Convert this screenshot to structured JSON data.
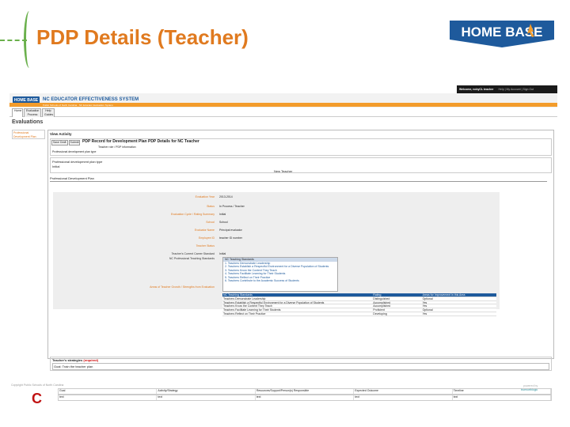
{
  "slide": {
    "title": "PDP Details (Teacher)",
    "logo_text": "HOME BASE"
  },
  "app": {
    "topbar": {
      "welcome": "Welcome, ncbyCL teacher",
      "links": "Help | My Account | Sign Out"
    },
    "logo_text": "HOME BASE",
    "system_name": "NC EDUCATOR EFFECTIVENESS SYSTEM",
    "breadcrumb": "Public Schools of North Carolina · NC Educator Evaluation System",
    "tabs": [
      "Home",
      "Evaluation Process",
      "Help Guides"
    ]
  },
  "evaluations": {
    "heading": "Evaluations",
    "sidebar_link": "Professional Development Plan",
    "view_activity": "View Activity",
    "buttons": [
      "Save Draft",
      "Submit"
    ],
    "pdp_title": "PDP Record for Development Plan PDP Details for NC Teacher",
    "pdp_subtitle": "Teacher role / PDP information",
    "pdp_info": "Professional development plan type",
    "type_label": "Professional development plan type",
    "type_value": "Initial",
    "category": "New Teacher",
    "plan_heading": "Professional Development Plan",
    "fields": [
      {
        "label": "Evaluation Year",
        "value": "2013-2014"
      },
      {
        "label": "Status",
        "value": "In Process / Teacher"
      },
      {
        "label": "Evaluation Cycle / Rating Summary",
        "value": "Initial"
      },
      {
        "label": "School",
        "value": "School"
      },
      {
        "label": "Evaluator Name",
        "value": "Principal evaluator"
      },
      {
        "label": "Employee ID",
        "value": "teacher ID number"
      },
      {
        "label": "Teacher Status",
        "value": ""
      },
      {
        "label": "Teacher's Current Career Standard",
        "value": "Initial"
      },
      {
        "label": "NC Professional Teaching Standards",
        "value": ""
      }
    ],
    "standards_header": "NC Teaching Standards",
    "standards_list": [
      "1. Teachers Demonstrate Leadership",
      "2. Teachers Establish a Respectful Environment for a Diverse Population of Students",
      "3. Teachers Know the Content They Teach",
      "4. Teachers Facilitate Learning for Their Students",
      "5. Teachers Reflect on Their Practice",
      "6. Teachers Contribute to the Academic Success of Students"
    ],
    "areas_label": "Areas of Teacher Growth / Strengths from Evaluation",
    "table_headers": [
      "NC Teaching Standards",
      "Rating",
      "Areas for Improvement in this Area"
    ],
    "table_rows": [
      [
        "Teachers Demonstrate Leadership",
        "Distinguished",
        "Optional"
      ],
      [
        "Teachers Establish a Respectful Environment for a Diverse Population of Students",
        "Accomplished",
        "Yes"
      ],
      [
        "Teachers Know the Content They Teach",
        "Accomplished",
        "Yes"
      ],
      [
        "Teachers Facilitate Learning for Their Students",
        "Proficient",
        "Optional"
      ],
      [
        "Teachers Reflect on Their Practice",
        "Developing",
        "Yes"
      ]
    ],
    "scroll_glyphs": [
      "▲",
      "▼",
      "▲",
      "▼"
    ],
    "strategies_label": "Teacher's strategies",
    "strategies_required": "(required)",
    "strategies_value": "Goal: Train the teacher plan",
    "bottom_headers": [
      "Goal",
      "Activity/Strategy",
      "Resources/Support/Person(s) Responsible",
      "Expected Outcome",
      "Timeline"
    ],
    "bottom_values": [
      "text",
      "text",
      "text",
      "text",
      "text"
    ]
  },
  "footer": {
    "left": "Copyright Public Schools of North Carolina",
    "c_letter": "C",
    "right_small": "powered by",
    "right_brand": "truenorthlogic"
  }
}
